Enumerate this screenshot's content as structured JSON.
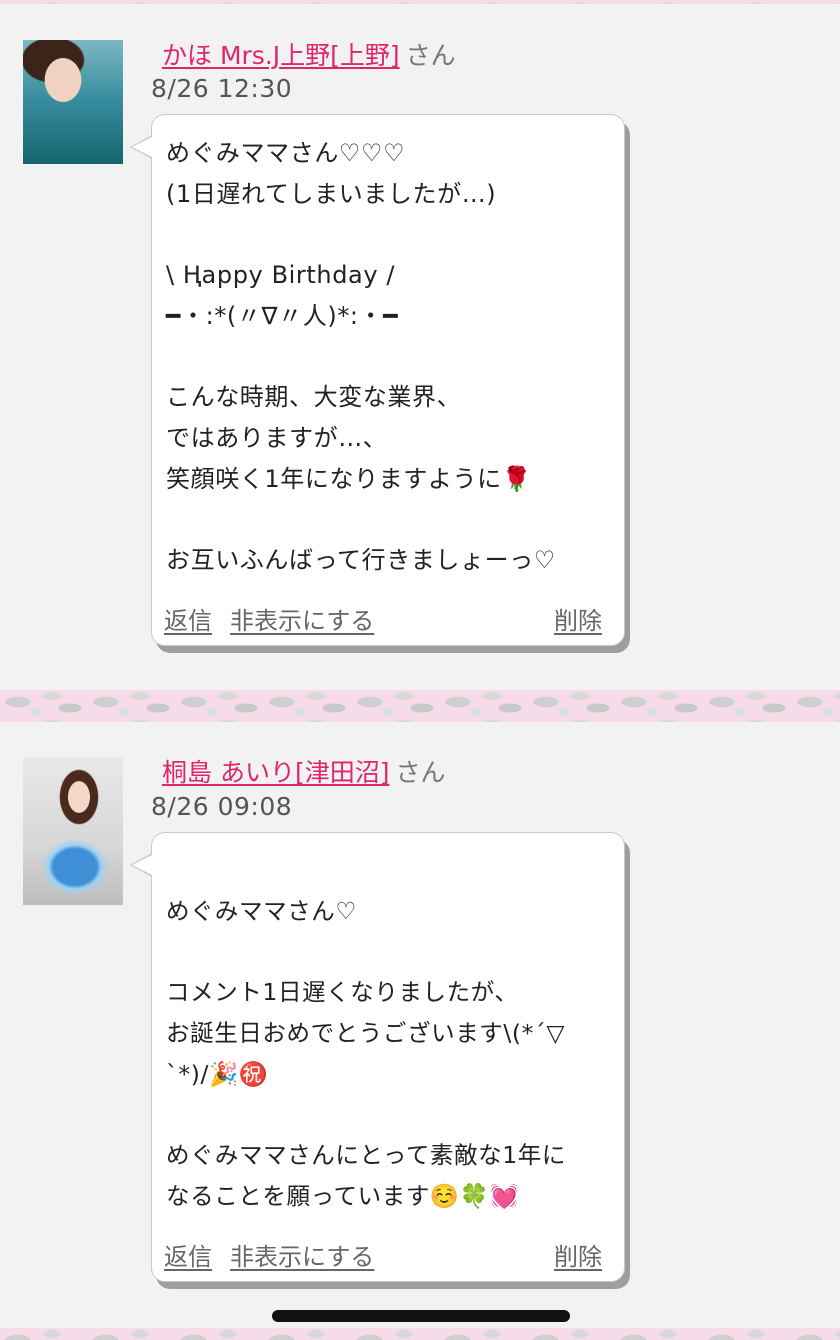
{
  "posts": [
    {
      "author_name": "かほ Mrs.J上野[上野]",
      "author_suffix": "さん",
      "timestamp": "8/26 12:30",
      "message": "めぐみママさん♡♡♡\n(1日遅れてしまいましたが…)\n\n\\ Ⱨappy Birthday /\n━・:*(〃∇〃人)*:・━\n\nこんな時期、大変な業界、\nではありますが…、\n笑顔咲く1年になりますように🌹\n\nお互いふんばって行きましょーっ♡",
      "actions": {
        "reply": "返信",
        "hide": "非表示にする",
        "delete": "削除"
      }
    },
    {
      "author_name": "桐島 あいり[津田沼]",
      "author_suffix": "さん",
      "timestamp": "8/26 09:08",
      "message": "\nめぐみママさん♡\n\nコメント1日遅くなりましたが、\nお誕生日おめでとうございます\\(*´▽\n`*)/🎉㊗️\n\nめぐみママさんにとって素敵な1年に\nなることを願っています☺️🍀💓",
      "actions": {
        "reply": "返信",
        "hide": "非表示にする",
        "delete": "削除"
      }
    }
  ],
  "colors": {
    "author_link": "#e0266b",
    "background": "#f2f2f2",
    "divider_pattern": "#f6dbe8"
  }
}
